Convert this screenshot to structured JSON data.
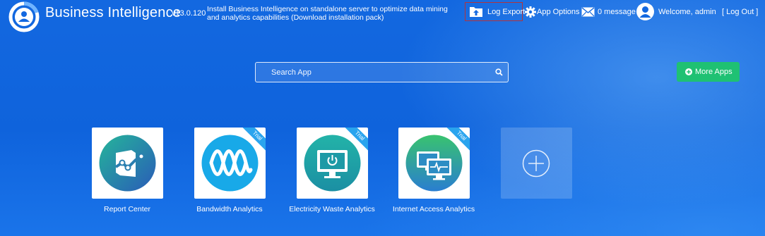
{
  "header": {
    "brand": "Business Intelligence",
    "version": "v13.0.120",
    "notice": "Install Business Intelligence on standalone server to optimize data mining and analytics capabilities (Download installation pack)",
    "log_export": "Log Export",
    "app_options": "App Options",
    "messages": "0 message",
    "welcome": "Welcome, admin",
    "logout": "[ Log Out ]"
  },
  "search": {
    "placeholder": "Search App"
  },
  "more_apps": "More Apps",
  "apps": [
    {
      "label": "Report Center",
      "icon": "report-center-icon",
      "trial": ""
    },
    {
      "label": "Bandwidth Analytics",
      "icon": "bandwidth-wave-icon",
      "trial": "Trial"
    },
    {
      "label": "Electricity Waste Analytics",
      "icon": "monitor-power-icon",
      "trial": "Trial"
    },
    {
      "label": "Internet Access Analytics",
      "icon": "monitors-activity-icon",
      "trial": "Trial"
    }
  ],
  "add_app_icon": "plus-circle-icon",
  "colors": {
    "background": "#1368e0",
    "more_apps_button": "#1fc173",
    "ribbon": "#2aa4ee"
  }
}
